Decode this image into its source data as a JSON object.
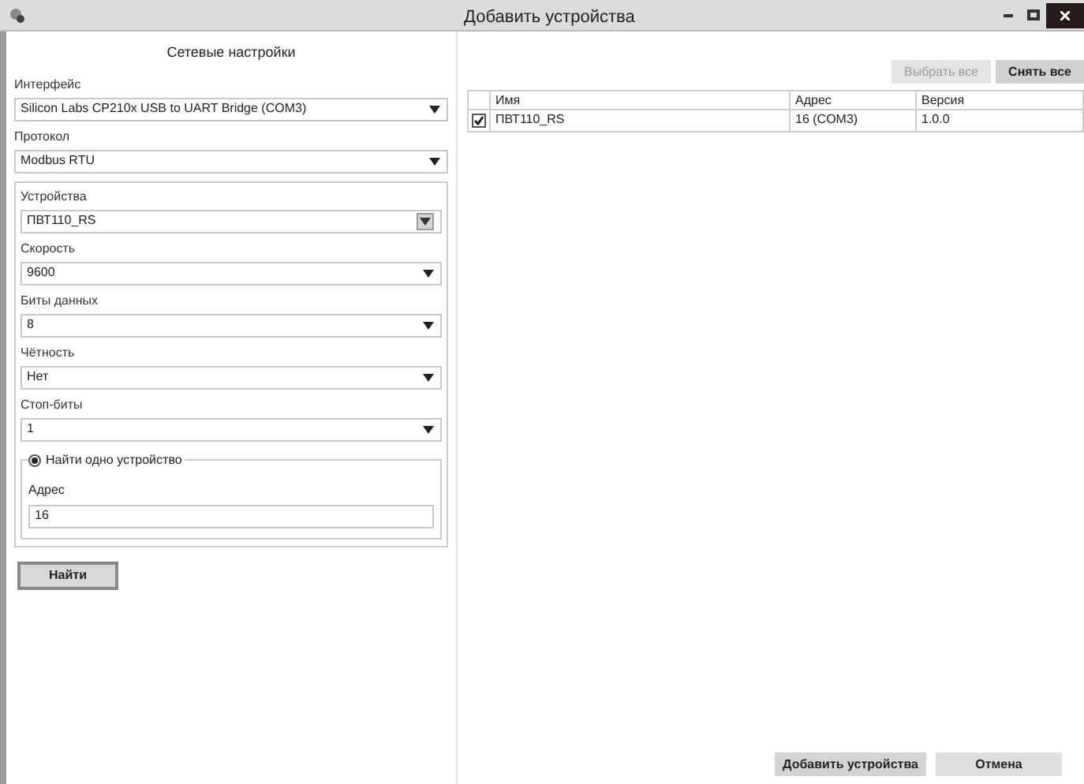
{
  "window": {
    "title": "Добавить устройства"
  },
  "settings": {
    "title": "Сетевые настройки",
    "fields": [
      {
        "label": "Интерфейс",
        "value": "Silicon Labs CP210x USB to UART Bridge (COM3)",
        "kind": "dropdown"
      },
      {
        "label": "Протокол",
        "value": "Modbus RTU",
        "kind": "dropdown"
      }
    ],
    "devices_group": {
      "fields": [
        {
          "label": "Устройства",
          "value": "ПВТ110_RS",
          "kind": "combo"
        },
        {
          "label": "Скорость",
          "value": "9600",
          "kind": "dropdown"
        },
        {
          "label": "Биты данных",
          "value": "8",
          "kind": "dropdown"
        },
        {
          "label": "Чётность",
          "value": "Нет",
          "kind": "dropdown"
        },
        {
          "label": "Стоп-биты",
          "value": "1",
          "kind": "dropdown"
        }
      ],
      "search_mode": {
        "label": "Найти одно устройство",
        "selected": true
      },
      "address": {
        "label": "Адрес",
        "value": "16"
      }
    },
    "find_button": "Найти"
  },
  "toolbar": [
    {
      "label": "Выбрать все",
      "disabled": true
    },
    {
      "label": "Снять все",
      "disabled": false
    }
  ],
  "table": {
    "columns": [
      "Имя",
      "Адрес",
      "Версия"
    ],
    "rows": [
      {
        "checked": true,
        "cells": [
          "ПВТ110_RS",
          "16 (COM3)",
          "1.0.0"
        ]
      }
    ]
  },
  "footer_buttons": [
    "Добавить устройства",
    "Отмена"
  ]
}
